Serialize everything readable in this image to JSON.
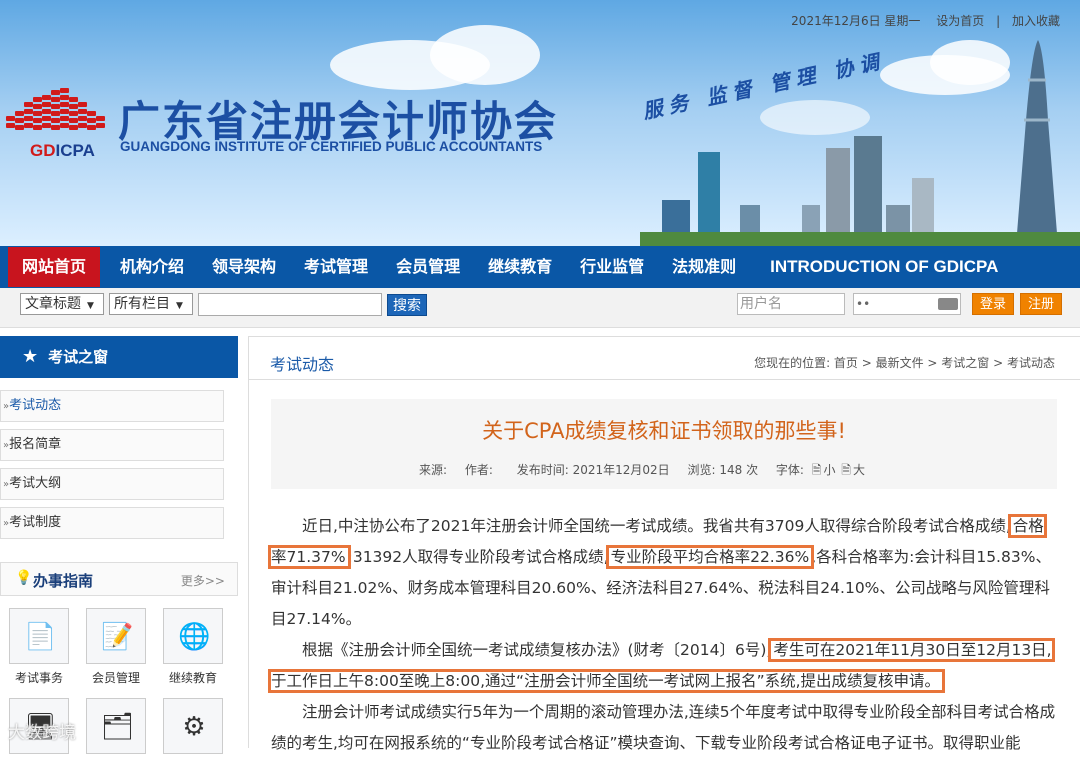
{
  "header": {
    "date": "2021年12月6日 星期一",
    "set_home": "设为首页",
    "separator": "|",
    "bookmark": "加入收藏",
    "logo_abbr_gd": "GD",
    "logo_abbr_icpa": "ICPA",
    "org_name_cn": "广东省注册会计师协会",
    "org_name_en": "GUANGDONG INSTITUTE OF CERTIFIED PUBLIC ACCOUNTANTS",
    "slogan": "服务 监督 管理 协调"
  },
  "nav": {
    "items": [
      "网站首页",
      "机构介绍",
      "领导架构",
      "考试管理",
      "会员管理",
      "继续教育",
      "行业监管",
      "法规准则",
      "INTRODUCTION OF GDICPA"
    ],
    "active_index": 0
  },
  "search": {
    "field_select": "文章标题",
    "column_select": "所有栏目",
    "keyword_value": "",
    "button": "搜索",
    "username_placeholder": "用户名",
    "password_value": "••",
    "login_button": "登录",
    "register_button": "注册"
  },
  "sidebar": {
    "title": "考试之窗",
    "items": [
      "考试动态",
      "报名简章",
      "考试大纲",
      "考试制度"
    ],
    "active_index": 0,
    "guide_title": "办事指南",
    "guide_more": "更多>>",
    "tiles": [
      "考试事务",
      "会员管理",
      "继续教育"
    ]
  },
  "main": {
    "section_title": "考试动态",
    "breadcrumb": "您现在的位置:  首页 > 最新文件 > 考试之窗 > 考试动态",
    "article_title": "关于CPA成绩复核和证书领取的那些事!",
    "meta": {
      "source": "来源:",
      "author": "作者:",
      "published": "发布时间: 2021年12月02日",
      "views": "浏览:  148 次",
      "font_label": "字体:",
      "font_small": "小",
      "font_large": "大"
    },
    "p1_a": "近日,中注协公布了2021年注册会计师全国统一考试成绩。我省共有3709人取得综合阶段考试合格成绩,",
    "p1_hl1": "合格率71.37%",
    "p1_b": ";31392人取得专业阶段考试合格成绩,",
    "p1_hl2": "专业阶段平均合格率22.36%",
    "p1_c": ",各科合格率为:会计科目15.83%、审计科目21.02%、财务成本管理科目20.60%、经济法科目27.64%、税法科目24.10%、公司战略与风险管理科目27.14%。",
    "p2_a": "根据《注册会计师全国统一考试成绩复核办法》(财考〔2014〕6号),",
    "p2_hl": "考生可在2021年11月30日至12月13日,于工作日上午8:00至晚上8:00,通过“注册会计师全国统一考试网上报名”系统,提出成绩复核申请。",
    "p3": "注册会计师考试成绩实行5年为一个周期的滚动管理办法,连续5个年度考试中取得专业阶段全部科目考试合格成绩的考生,均可在网报系统的“专业阶段考试合格证”模块查询、下载专业阶段考试合格证电子证书。取得职业能"
  },
  "watermark": "大数跨境",
  "colors": {
    "nav_bg": "#0a57a6",
    "nav_active": "#c8141e",
    "title_orange": "#d2641b",
    "highlight": "#e8753a",
    "button_orange": "#f08200"
  }
}
